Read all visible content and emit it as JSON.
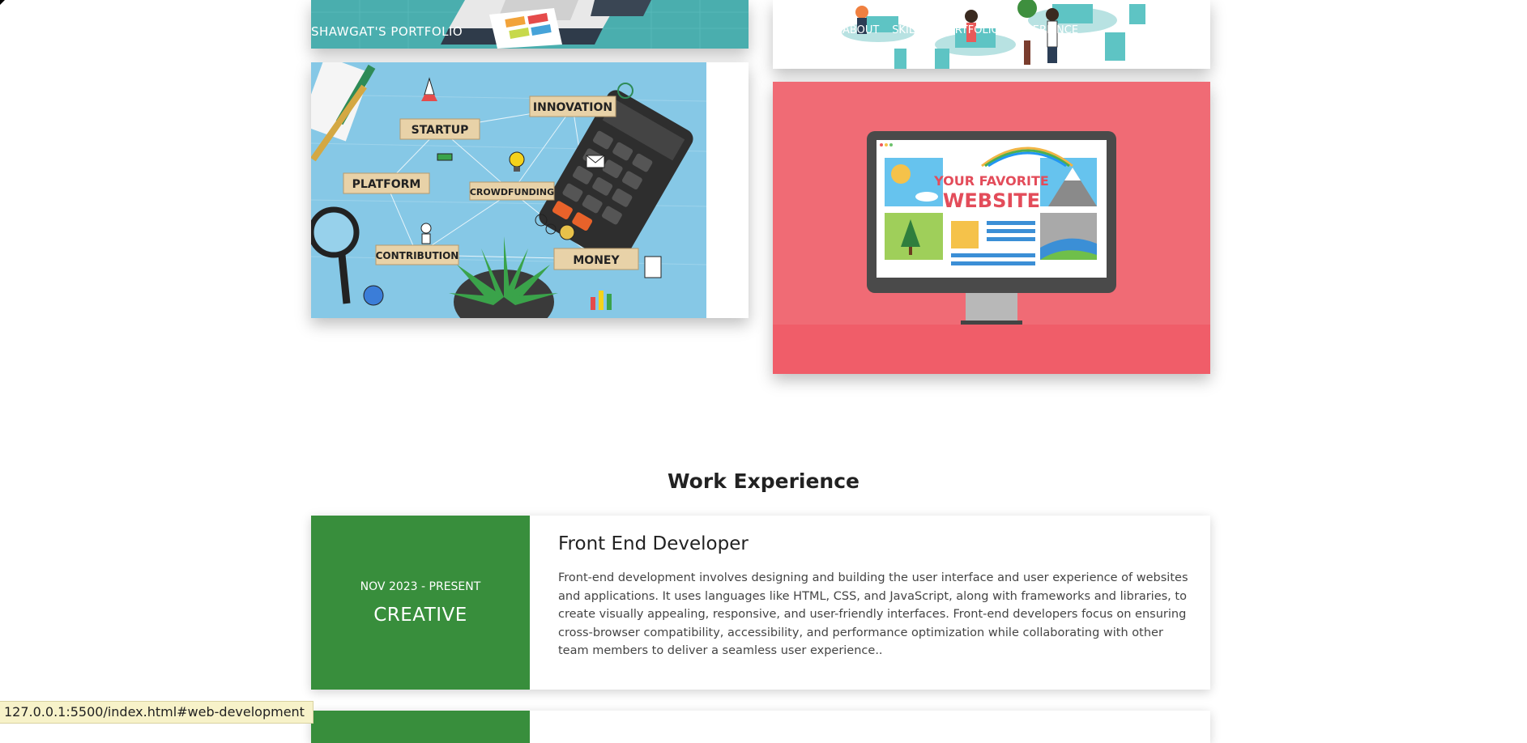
{
  "nav": {
    "brand": "SHAWGAT'S PORTFOLIO",
    "links": [
      "ABOUT",
      "SKILLS",
      "PORTFOLIO",
      "EXPERIENCE"
    ]
  },
  "portfolio": {
    "startup_words": [
      "STARTUP",
      "INNOVATION",
      "PLATFORM",
      "CROWDFUNDING",
      "CONTRIBUTION",
      "MONEY"
    ],
    "website_text": [
      "YOUR FAVORITE",
      "WEBSITE"
    ]
  },
  "section": {
    "title": "Work Experience"
  },
  "experience": [
    {
      "date": "NOV 2023 - PRESENT",
      "company": "CREATIVE",
      "title": "Front End Developer",
      "description": "Front-end development involves designing and building the user interface and user experience of websites and applications. It uses languages like HTML, CSS, and JavaScript, along with frameworks and libraries, to create visually appealing, responsive, and user-friendly interfaces. Front-end developers focus on ensuring cross-browser compatibility, accessibility, and performance optimization while collaborating with other team members to deliver a seamless user experience.."
    }
  ],
  "status_bar": {
    "url": "127.0.0.1:5500/index.html#web-development"
  },
  "colors": {
    "green": "#388e3c",
    "pink": "#f06b75",
    "teal": "#4aaeae",
    "blue_bg": "#7fc3e0"
  }
}
